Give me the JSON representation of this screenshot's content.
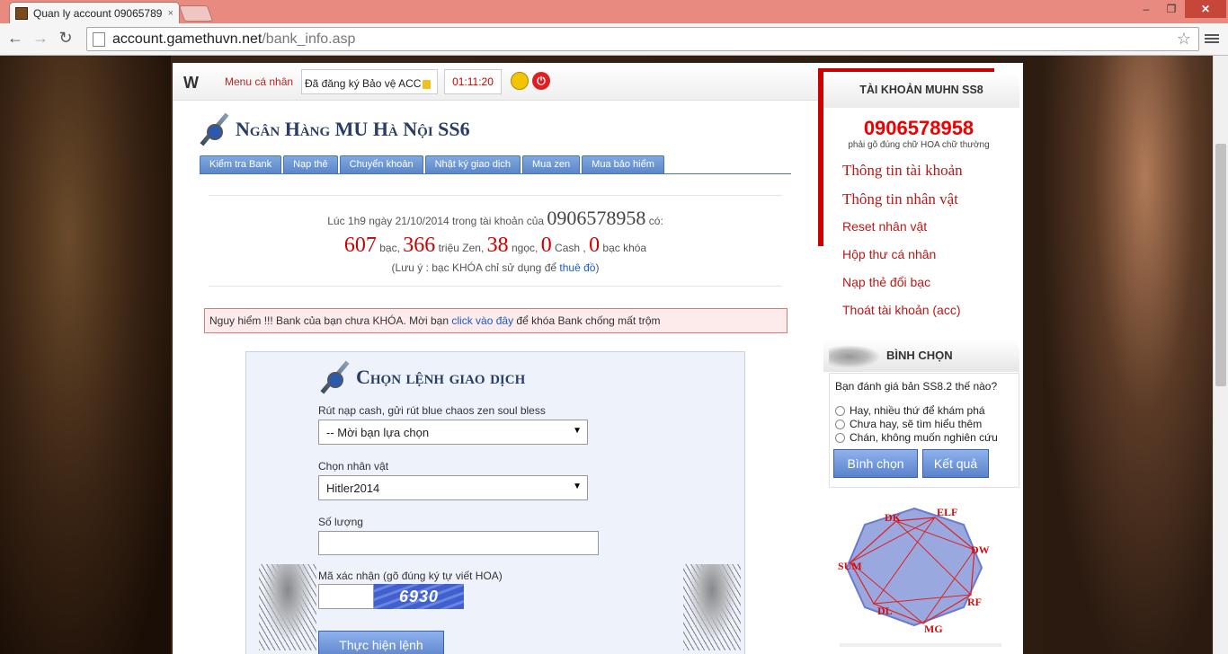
{
  "browser": {
    "tab_title": "Quan ly account 09065789",
    "tab_close": "×",
    "url_host": "account.gamethuvn.net",
    "url_path": "/bank_info.asp",
    "controls": {
      "minimize": "–",
      "maximize": "❐",
      "close": "✕"
    },
    "nav": {
      "back": "←",
      "forward": "→",
      "reload": "↻"
    },
    "star": "☆"
  },
  "topbar": {
    "logo": "W",
    "menu_label": "Menu cá nhân",
    "protect_text": "Đã đăng ký Bảo vệ ACC",
    "timer": "01:11:20",
    "power": "⏻"
  },
  "bank": {
    "title": "Ngân Hàng MU Hà Nội SS6",
    "tabs": [
      "Kiểm tra Bank",
      "Nạp thẻ",
      "Chuyển khoản",
      "Nhật ký giao dịch",
      "Mua zen",
      "Mua bảo hiểm"
    ],
    "summary_prefix": "Lúc 1h9 ngày 21/10/2014 trong tài khoản của",
    "account": "0906578958",
    "summary_suffix": "có:",
    "bac_value": "607",
    "bac_label": "bạc,",
    "zen_value": "366",
    "zen_label": "triệu Zen,",
    "ngoc_value": "38",
    "ngoc_label": "ngọc,",
    "cash_value": "0",
    "cash_label": "Cash ,",
    "khoa_value": "0",
    "khoa_label": "bạc khóa",
    "note_prefix": "(Lưu ý : bạc KHÓA chỉ sử dụng để",
    "note_link": "thuê đồ",
    "note_suffix": ")"
  },
  "warning": {
    "prefix": "Nguy hiểm !!! Bank của bạn chưa KHÓA. Mời bạn",
    "link": "click vào đây",
    "suffix": "để khóa Bank chống mất trộm"
  },
  "form": {
    "title": "Chọn lệnh giao dịch",
    "command_label": "Rút nạp cash, gửi rút blue chaos zen soul bless",
    "command_value": "-- Mời bạn lựa chọn",
    "character_label": "Chọn nhân vật",
    "character_value": "Hitler2014",
    "quantity_label": "Số lượng",
    "captcha_label": "Mã xác nhận (gõ đúng ký tự viết HOA)",
    "captcha_text": "6930",
    "submit": "Thực hiện lệnh"
  },
  "sidebar": {
    "title": "TÀI KHOẢN MUHN SS8",
    "account": "0906578958",
    "hint": "phải gõ đúng chữ HOA chữ thường",
    "links_big": [
      "Thông tin tài khoản",
      "Thông tin nhân vật"
    ],
    "links": [
      "Reset nhân vật",
      "Hộp thư cá nhân",
      "Nạp thẻ đổi bạc",
      "Thoát tài khoản (acc)"
    ]
  },
  "vote": {
    "title": "BÌNH CHỌN",
    "question": "Bạn đánh giá bản SS8.2 thế nào?",
    "options": [
      "Hay, nhiều thứ để khám phá",
      "Chưa hay, sẽ tìm hiểu thêm",
      "Chán, không muốn nghiên cứu"
    ],
    "vote_button": "Bình chọn",
    "result_button": "Kết quả"
  },
  "classes": [
    "DK",
    "ELF",
    "DW",
    "RF",
    "MG",
    "DL",
    "SUM"
  ]
}
